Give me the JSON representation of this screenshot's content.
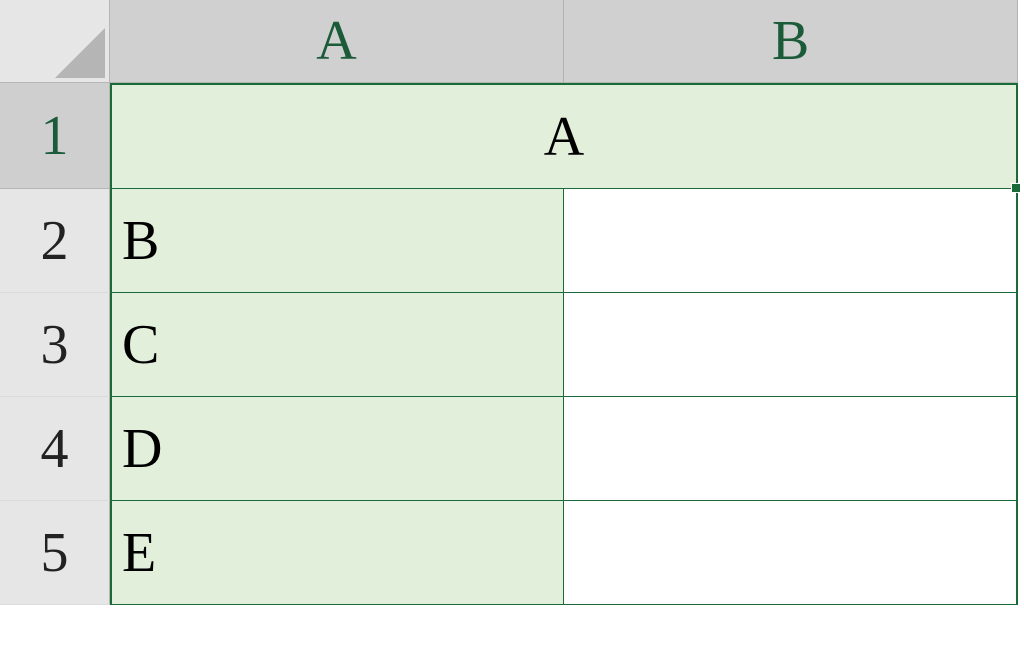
{
  "columns": {
    "A": "A",
    "B": "B"
  },
  "rows": {
    "1": "1",
    "2": "2",
    "3": "3",
    "4": "4",
    "5": "5"
  },
  "cells": {
    "A1_merged": "A",
    "A2": "B",
    "B2": "",
    "A3": "C",
    "B3": "",
    "A4": "D",
    "B4": "",
    "A5": "E",
    "B5": ""
  },
  "colors": {
    "tableBorder": "#1b6b3a",
    "tableFill": "#e2efdb",
    "headerBg": "#d0d0d0",
    "rowHeaderBg": "#e6e6e6",
    "headerFontGreen": "#1b5b3a"
  }
}
